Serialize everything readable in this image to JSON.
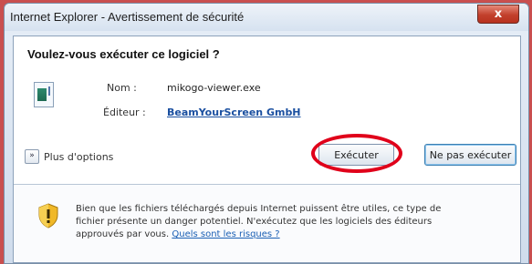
{
  "window": {
    "title": "Internet Explorer - Avertissement de sécurité",
    "close_glyph": "x"
  },
  "dialog": {
    "question": "Voulez-vous exécuter ce logiciel ?",
    "name_label": "Nom :",
    "name_value": "mikogo-viewer.exe",
    "publisher_label": "Éditeur :",
    "publisher_value": "BeamYourScreen GmbH"
  },
  "more_options": {
    "label": "Plus d'options",
    "chevron": "»"
  },
  "buttons": {
    "run": "Exécuter",
    "dont_run": "Ne pas exécuter"
  },
  "warning": {
    "text": "Bien que les fichiers téléchargés depuis Internet puissent être utiles, ce type de fichier présente un danger potentiel. N'exécutez que les logiciels des éditeurs approuvés par vous.",
    "link": "Quels sont les risques ?"
  },
  "colors": {
    "accent_link": "#1a4fa0",
    "highlight_ring": "#e0001a",
    "close_button": "#c2402c"
  }
}
